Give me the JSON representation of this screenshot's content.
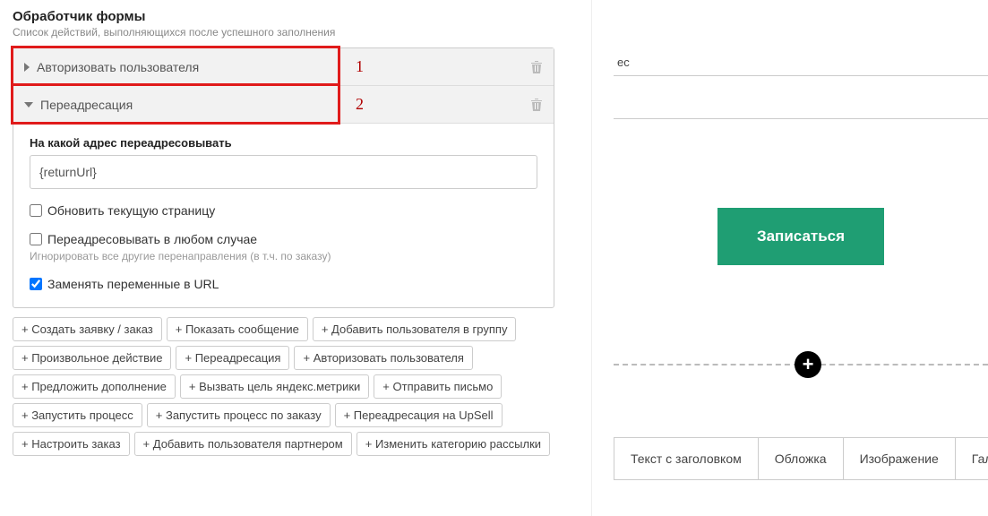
{
  "panel": {
    "title": "Обработчик формы",
    "subtitle": "Список действий, выполняющихся после успешного заполнения"
  },
  "actions": [
    {
      "key": "authorize",
      "title": "Авторизовать пользователя",
      "open": false,
      "annotation_num": "1"
    },
    {
      "key": "redirect",
      "title": "Переадресация",
      "open": true,
      "annotation_num": "2",
      "fields": {
        "url_label": "На какой адрес переадресовывать",
        "url_value": "{returnUrl}",
        "refresh_label": "Обновить текущую страницу",
        "refresh_checked": false,
        "always_label": "Переадресовывать в любом случае",
        "always_checked": false,
        "always_help": "Игнорировать все другие перенаправления (в т.ч. по заказу)",
        "replace_vars_label": "Заменять переменные в URL",
        "replace_vars_checked": true
      }
    }
  ],
  "add_actions": [
    "+ Создать заявку / заказ",
    "+ Показать сообщение",
    "+ Добавить пользователя в группу",
    "+ Произвольное действие",
    "+ Переадресация",
    "+ Авторизовать пользователя",
    "+ Предложить дополнение",
    "+ Вызвать цель яндекс.метрики",
    "+ Отправить письмо",
    "+ Запустить процесс",
    "+ Запустить процесс по заказу",
    "+ Переадресация на UpSell",
    "+ Настроить заказ",
    "+ Добавить пользователя партнером",
    "+ Изменить категорию рассылки"
  ],
  "right": {
    "partial_text": "ес",
    "cta_label": "Записаться",
    "tabs": [
      "Текст с заголовком",
      "Обложка",
      "Изображение",
      "Гал"
    ]
  }
}
